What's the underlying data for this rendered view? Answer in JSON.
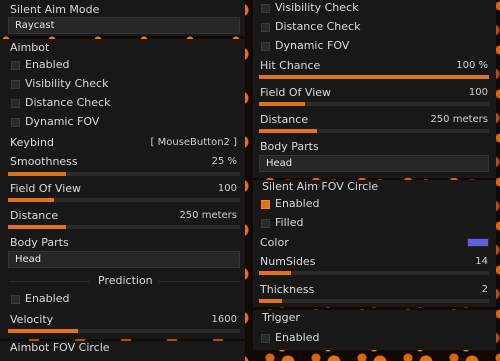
{
  "left": {
    "silent_aim_mode": {
      "title": "Silent Aim Mode",
      "value": "Raycast"
    },
    "aimbot": {
      "title": "Aimbot",
      "enabled": "Enabled",
      "visibility_check": "Visibility Check",
      "distance_check": "Distance Check",
      "dynamic_fov": "Dynamic FOV",
      "keybind_label": "Keybind",
      "keybind_value": "[ MouseButton2 ]",
      "smoothness_label": "Smoothness",
      "smoothness_value": "25 %",
      "smoothness_fraction": 0.25,
      "fov_label": "Field Of View",
      "fov_value": "100",
      "fov_fraction": 0.2,
      "distance_label": "Distance",
      "distance_value": "250 meters",
      "distance_fraction": 0.25,
      "body_parts_label": "Body Parts",
      "body_parts_value": "Head",
      "prediction_label": "Prediction",
      "prediction_enabled": "Enabled",
      "velocity_label": "Velocity",
      "velocity_value": "1600",
      "velocity_fraction": 0.3
    },
    "aimbot_fov_circle": {
      "title": "Aimbot FOV Circle"
    }
  },
  "right": {
    "silent_aim": {
      "visibility_check": "Visibility Check",
      "distance_check": "Distance Check",
      "dynamic_fov": "Dynamic FOV",
      "hit_chance_label": "Hit Chance",
      "hit_chance_value": "100 %",
      "hit_chance_fraction": 1.0,
      "fov_label": "Field Of View",
      "fov_value": "100",
      "fov_fraction": 0.2,
      "distance_label": "Distance",
      "distance_value": "250 meters",
      "distance_fraction": 0.25,
      "body_parts_label": "Body Parts",
      "body_parts_value": "Head"
    },
    "silent_aim_fov_circle": {
      "title": "Silent Aim FOV Circle",
      "enabled": "Enabled",
      "filled": "Filled",
      "color_label": "Color",
      "color_value": "#5f5fd9",
      "numsides_label": "NumSides",
      "numsides_value": "14",
      "numsides_fraction": 0.14,
      "thickness_label": "Thickness",
      "thickness_value": "2",
      "thickness_fraction": 0.1
    },
    "trigger": {
      "title": "Trigger",
      "enabled": "Enabled"
    }
  },
  "colors": {
    "accent": "#e0721a",
    "panel": "#181818",
    "control": "#262626"
  }
}
